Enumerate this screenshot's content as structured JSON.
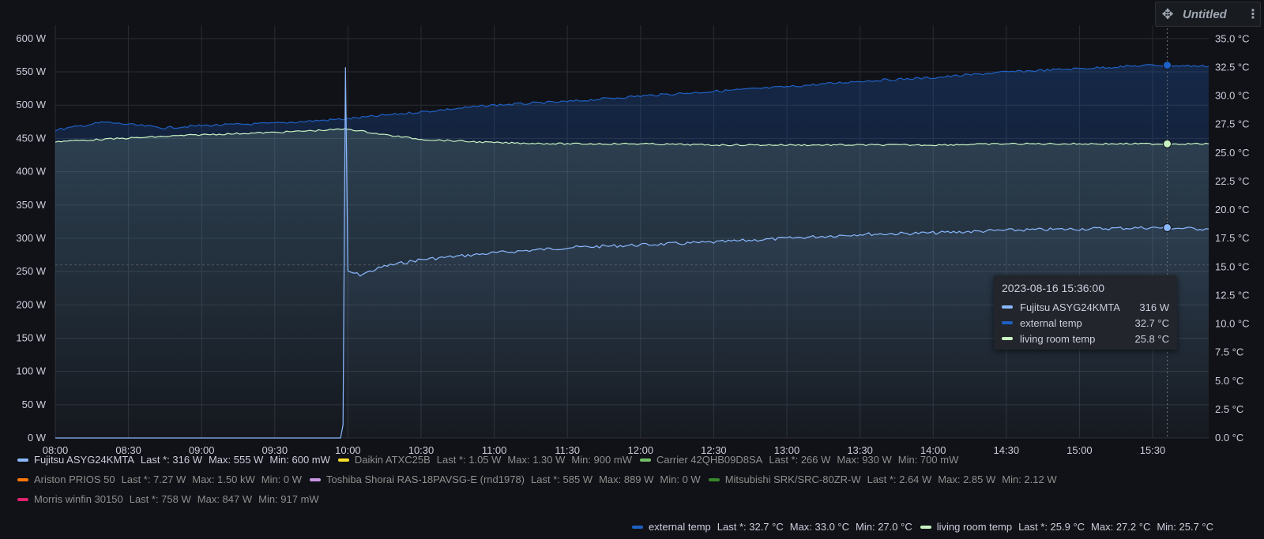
{
  "panel": {
    "title": "Untitled"
  },
  "chart_data": {
    "type": "line",
    "x_ticks": [
      "08:00",
      "08:30",
      "09:00",
      "09:30",
      "10:00",
      "10:30",
      "11:00",
      "11:30",
      "12:00",
      "12:30",
      "13:00",
      "13:30",
      "14:00",
      "14:30",
      "15:00",
      "15:30"
    ],
    "x_range": [
      "2023-08-16 08:00",
      "2023-08-16 15:53"
    ],
    "y_left": {
      "unit": "W",
      "range": [
        0,
        620
      ],
      "ticks": [
        "0 W",
        "50 W",
        "100 W",
        "150 W",
        "200 W",
        "250 W",
        "300 W",
        "350 W",
        "400 W",
        "450 W",
        "500 W",
        "550 W",
        "600 W"
      ]
    },
    "y_right": {
      "unit": "°C",
      "range": [
        0,
        36.2
      ],
      "ticks": [
        "0.0 °C",
        "2.5 °C",
        "5.0 °C",
        "7.5 °C",
        "10.0 °C",
        "12.5 °C",
        "15.0 °C",
        "17.5 °C",
        "20.0 °C",
        "22.5 °C",
        "25.0 °C",
        "27.5 °C",
        "30.0 °C",
        "32.5 °C",
        "35.0 °C"
      ]
    },
    "grid": true,
    "threshold_line_w": 260,
    "series": [
      {
        "name": "Fujitsu ASYG24KMTA",
        "axis": "left",
        "color": "#8ab8ff",
        "points": [
          [
            "08:00",
            0
          ],
          [
            "09:57",
            0
          ],
          [
            "09:58",
            20
          ],
          [
            "09:59",
            555
          ],
          [
            "10:00",
            250
          ],
          [
            "10:05",
            245
          ],
          [
            "10:15",
            258
          ],
          [
            "10:30",
            268
          ],
          [
            "11:00",
            278
          ],
          [
            "11:30",
            286
          ],
          [
            "12:00",
            290
          ],
          [
            "12:30",
            294
          ],
          [
            "13:00",
            300
          ],
          [
            "13:30",
            306
          ],
          [
            "14:00",
            308
          ],
          [
            "14:30",
            312
          ],
          [
            "15:00",
            314
          ],
          [
            "15:30",
            316
          ],
          [
            "15:53",
            314
          ]
        ]
      },
      {
        "name": "external temp",
        "axis": "right",
        "color": "#1f60c4",
        "points": [
          [
            "08:00",
            27.0
          ],
          [
            "08:20",
            27.7
          ],
          [
            "08:45",
            27.2
          ],
          [
            "09:00",
            27.4
          ],
          [
            "09:30",
            27.6
          ],
          [
            "10:00",
            28.0
          ],
          [
            "10:30",
            28.6
          ],
          [
            "11:00",
            29.2
          ],
          [
            "11:30",
            29.5
          ],
          [
            "12:00",
            30.0
          ],
          [
            "12:30",
            30.4
          ],
          [
            "13:00",
            30.8
          ],
          [
            "13:30",
            31.3
          ],
          [
            "14:00",
            31.6
          ],
          [
            "14:30",
            32.1
          ],
          [
            "15:00",
            32.4
          ],
          [
            "15:30",
            32.7
          ],
          [
            "15:53",
            32.6
          ]
        ]
      },
      {
        "name": "living room temp",
        "axis": "right",
        "color": "#c8f2c2",
        "points": [
          [
            "08:00",
            26.0
          ],
          [
            "08:30",
            26.3
          ],
          [
            "09:00",
            26.6
          ],
          [
            "09:30",
            26.8
          ],
          [
            "10:00",
            27.1
          ],
          [
            "10:15",
            26.6
          ],
          [
            "10:30",
            26.2
          ],
          [
            "11:00",
            25.9
          ],
          [
            "11:30",
            25.8
          ],
          [
            "12:00",
            25.8
          ],
          [
            "12:30",
            25.7
          ],
          [
            "13:00",
            25.7
          ],
          [
            "13:30",
            25.7
          ],
          [
            "14:00",
            25.7
          ],
          [
            "14:30",
            25.8
          ],
          [
            "15:00",
            25.8
          ],
          [
            "15:30",
            25.8
          ],
          [
            "15:53",
            25.8
          ]
        ]
      }
    ],
    "cursor": {
      "time": "15:36",
      "title": "2023-08-16 15:36:00",
      "rows": [
        {
          "name": "Fujitsu ASYG24KMTA",
          "value": "316 W",
          "color": "#8ab8ff"
        },
        {
          "name": "external temp",
          "value": "32.7 °C",
          "color": "#1f60c4"
        },
        {
          "name": "living room temp",
          "value": "25.8 °C",
          "color": "#c8f2c2"
        }
      ]
    }
  },
  "legend": {
    "rows": [
      [
        {
          "name": "Fujitsu ASYG24KMTA",
          "color": "#8ab8ff",
          "active": true,
          "last": "Last *: 316 W",
          "max": "Max: 555 W",
          "min": "Min: 600 mW"
        },
        {
          "name": "Daikin ATXC25B",
          "color": "#fade2a",
          "active": false,
          "last": "Last *: 1.05 W",
          "max": "Max: 1.30 W",
          "min": "Min: 900 mW"
        },
        {
          "name": "Carrier 42QHB09D8SA",
          "color": "#73bf69",
          "active": false,
          "last": "Last *: 266 W",
          "max": "Max: 930 W",
          "min": "Min: 700 mW"
        }
      ],
      [
        {
          "name": "Ariston PRIOS 50",
          "color": "#ff780a",
          "active": false,
          "last": "Last *: 7.27 W",
          "max": "Max: 1.50 kW",
          "min": "Min: 0 W"
        },
        {
          "name": "Toshiba Shorai RAS-18PAVSG-E (rnd1978)",
          "color": "#ca95e5",
          "active": false,
          "last": "Last *: 585 W",
          "max": "Max: 889 W",
          "min": "Min: 0 W"
        },
        {
          "name": "Mitsubishi SRK/SRC-80ZR-W",
          "color": "#37872d",
          "active": false,
          "last": "Last *: 2.64 W",
          "max": "Max: 2.85 W",
          "min": "Min: 2.12 W"
        }
      ],
      [
        {
          "name": "Morris winfin 30150",
          "color": "#e0226e",
          "active": false,
          "last": "Last *: 758 W",
          "max": "Max: 847 W",
          "min": "Min: 917 mW"
        }
      ]
    ],
    "right_row": [
      {
        "name": "external temp",
        "color": "#1f60c4",
        "active": true,
        "last": "Last *: 32.7 °C",
        "max": "Max: 33.0 °C",
        "min": "Min: 27.0 °C"
      },
      {
        "name": "living room temp",
        "color": "#c8f2c2",
        "active": true,
        "last": "Last *: 25.9 °C",
        "max": "Max: 27.2 °C",
        "min": "Min: 25.7 °C"
      }
    ]
  }
}
